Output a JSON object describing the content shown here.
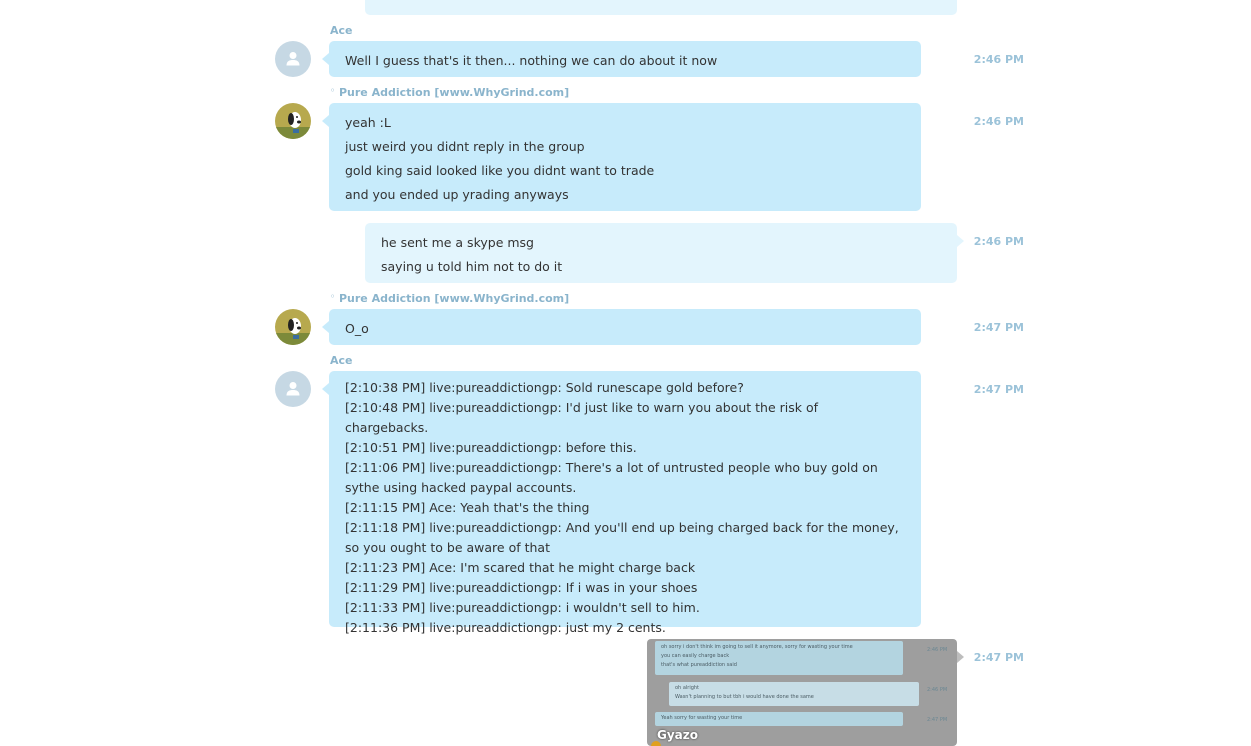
{
  "messages": [
    {
      "sender": "Ace",
      "lines": [
        "Well I guess that's it then... nothing we can do about it now"
      ],
      "time": "2:46 PM"
    },
    {
      "sender": "Pure Addiction [www.WhyGrind.com]",
      "lines": [
        "yeah :L",
        "just weird you didnt reply in the group",
        "gold king said looked like you didnt want to trade",
        "and you ended up yrading anyways"
      ],
      "time": "2:46 PM"
    },
    {
      "sender": "",
      "lines": [
        "he sent me a skype msg",
        "saying u told him not to do it"
      ],
      "time": "2:46 PM"
    },
    {
      "sender": "Pure Addiction [www.WhyGrind.com]",
      "lines": [
        "O_o"
      ],
      "time": "2:47 PM"
    },
    {
      "sender": "Ace",
      "lines": [
        "[2:10:38 PM] live:pureaddictiongp: Sold runescape gold before?",
        "[2:10:48 PM] live:pureaddictiongp: I'd just like to warn you about the risk of chargebacks.",
        "[2:10:51 PM] live:pureaddictiongp: before this.",
        "[2:11:06 PM] live:pureaddictiongp: There's a lot of untrusted people who buy gold on sythe using hacked paypal accounts.",
        "[2:11:15 PM] Ace: Yeah that's the thing",
        "[2:11:18 PM] live:pureaddictiongp: And you'll end up being charged back for the money, so you ought to be aware of that",
        "[2:11:23 PM] Ace: I'm scared that he might charge back",
        "[2:11:29 PM] live:pureaddictiongp: If i was in your shoes",
        "[2:11:33 PM] live:pureaddictiongp: i wouldn't sell to him.",
        "[2:11:36 PM] live:pureaddictiongp: just my 2 cents."
      ],
      "time": "2:47 PM"
    },
    {
      "sender": "",
      "image_label": "Gyazo",
      "thumb_lines": [
        "oh sorry i don't think im going to sell it anymore, sorry for wasting your time",
        "you can easily charge back",
        "that's what pureaddiction said",
        "oh alright",
        "Wasn't planning to but tbh i would have done the same",
        "Yeah sorry for wasting your time"
      ],
      "time": "2:47 PM"
    }
  ]
}
